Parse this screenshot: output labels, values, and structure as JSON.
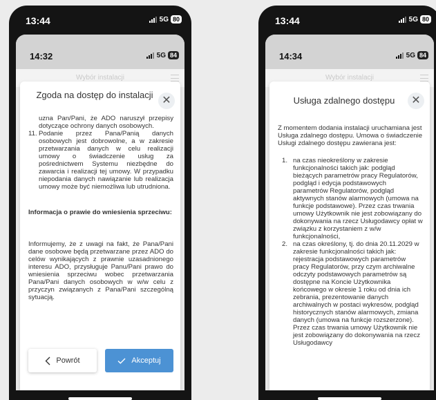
{
  "left_phone": {
    "outer_time": "13:44",
    "outer_network": "5G",
    "outer_battery": "80",
    "inner_time": "14:32",
    "inner_network": "5G",
    "inner_battery": "84",
    "app_header": "Wybór instalacji",
    "modal_title": "Zgoda na dostęp do instalacji",
    "close_symbol": "✕",
    "top_fragment": "uzna Pan/Pani, że ADO naruszył przepisy dotyczące ochrony danych osobowych.",
    "item_11_number": "11.",
    "item_11_text": "Podanie przez Pana/Panią danych osobowych jest dobrowolne, a w zakresie przetwarzania danych w celu realizacji umowy o świadczenie usług za pośrednictwem Systemu niezbędne do zawarcia i realizacji tej umowy. W przypadku niepodania danych nawiązanie lub realizacja umowy może być niemożliwa lub utrudniona.",
    "section_heading": "Informacja o prawie do wniesienia sprzeciwu:",
    "section_text": "Informujemy, że z uwagi na fakt, że Pana/Pani dane osobowe będą przetwarzane przez ADO do celów wynikających z prawnie uzasadnionego interesu ADO, przysługuje Panu/Pani prawo do wniesienia sprzeciwu wobec przetwarzania Pana/Pani danych osobowych w w/w celu z przyczyn związanych z Pana/Pani szczególną sytuacją.",
    "back_label": "Powrót",
    "back_icon": "chevron-left",
    "accept_label": "Akceptuj",
    "accept_icon": "checkmark",
    "accent_color": "#4c92d4"
  },
  "right_phone": {
    "outer_time": "13:44",
    "outer_network": "5G",
    "outer_battery": "80",
    "inner_time": "14:34",
    "inner_network": "5G",
    "inner_battery": "84",
    "app_header": "Wybór instalacji",
    "modal_title": "Usługa zdalnego dostępu",
    "close_symbol": "✕",
    "intro": "Z momentem dodania instalacji uruchamiana jest Usługa zdalnego dostępu. Umowa o świadczenie Usługi zdalnego dostępu zawierana jest:",
    "items": [
      {
        "number": "1.",
        "text": "na czas nieokreślony w zakresie funkcjonalności takich jak: podgląd bieżących parametrów pracy Regulatorów, podgląd i edycja podstawowych parametrów Regulatorów, podgląd aktywnych stanów alarmowych (umowa na funkcje podstawowe). Przez czas trwania umowy Użytkownik nie jest zobowiązany do dokonywania na rzecz Usługodawcy opłat w związku z korzystaniem z w/w funkcjonalności,"
      },
      {
        "number": "2.",
        "text": "na czas określony, tj. do dnia 20.11.2029 w zakresie funkcjonalności takich jak: rejestracja podstawowych parametrów pracy Regulatorów, przy czym archiwalne odczyty podstawowych parametrów są dostępne na Koncie Użytkownika końcowego w okresie 1 roku od dnia ich zebrania, prezentowanie danych archiwalnych w postaci wykresów, podgląd historycznych stanów alarmowych, zmiana danych (umowa na funkcje rozszerzone). Przez czas trwania umowy Użytkownik nie jest zobowiązany do dokonywania na rzecz Usługodawcy"
      }
    ]
  }
}
